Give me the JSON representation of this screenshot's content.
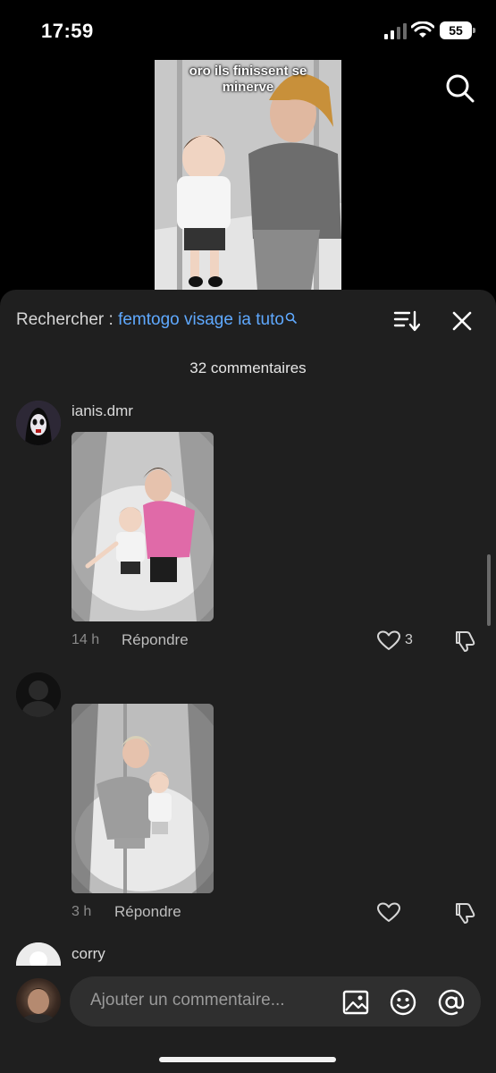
{
  "status_bar": {
    "time": "17:59",
    "battery": "55"
  },
  "video": {
    "caption_line1": "oro ils finissent se",
    "caption_line2": "minerve"
  },
  "sheet": {
    "search_label": "Rechercher :",
    "search_query": "femtogo visage ia tuto",
    "comment_count": "32 commentaires"
  },
  "comments": [
    {
      "username": "ianis.dmr",
      "time": "14 h",
      "reply": "Répondre",
      "likes": "3"
    },
    {
      "username": "",
      "time": "3 h",
      "reply": "Répondre",
      "likes": ""
    },
    {
      "username": "corry"
    }
  ],
  "composer": {
    "placeholder": "Ajouter un commentaire..."
  },
  "icons": [
    "search-icon",
    "sort-icon",
    "close-icon",
    "heart-icon",
    "dislike-icon",
    "image-icon",
    "emoji-icon",
    "at-icon"
  ],
  "colors": {
    "accent": "#5fa9ff",
    "sheet": "#1f1f1f",
    "input": "#2f2f2f"
  }
}
